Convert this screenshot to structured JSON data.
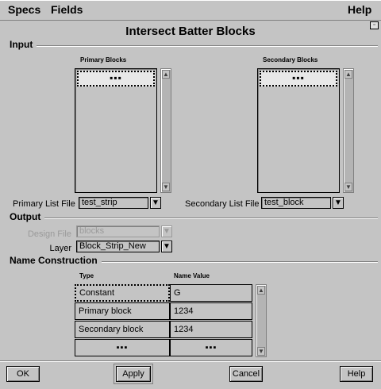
{
  "menubar": {
    "specs": "Specs",
    "fields": "Fields",
    "help": "Help"
  },
  "window_title": "Intersect Batter Blocks",
  "tearoff_icon": "▫",
  "input": {
    "section_label": "Input",
    "primary_header": "Primary Blocks",
    "secondary_header": "Secondary Blocks",
    "primary_list_item": "▪▪▪",
    "secondary_list_item": "▪▪▪",
    "primary_list_file_label": "Primary List File",
    "primary_list_file_value": "test_strip",
    "secondary_list_file_label": "Secondary List File",
    "secondary_list_file_value": "test_block"
  },
  "output": {
    "section_label": "Output",
    "design_file_label": "Design File",
    "design_file_value": "blocks",
    "layer_label": "Layer",
    "layer_value": "Block_Strip_New"
  },
  "name_construction": {
    "section_label": "Name Construction",
    "col_type": "Type",
    "col_value": "Name Value",
    "rows": [
      {
        "type": "Constant",
        "value": "G"
      },
      {
        "type": "Primary block",
        "value": "1234"
      },
      {
        "type": "Secondary block",
        "value": "1234"
      },
      {
        "type": "▪▪▪",
        "value": "▪▪▪"
      }
    ]
  },
  "buttons": {
    "ok": "OK",
    "apply": "Apply",
    "cancel": "Cancel",
    "help": "Help"
  },
  "icons": {
    "arrow_up": "▲",
    "arrow_down": "▼"
  }
}
